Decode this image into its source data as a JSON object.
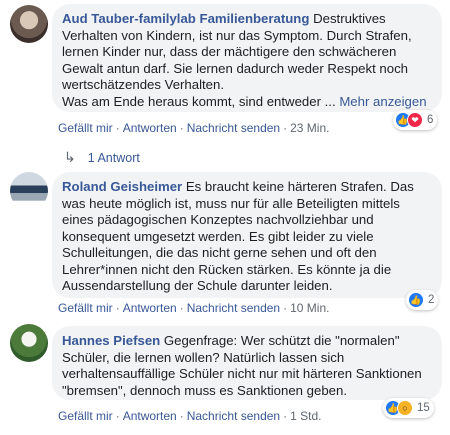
{
  "comments": [
    {
      "author": "Aud Tauber-familylab Familienberatung",
      "text": " Destruktives Verhalten von Kindern, ist nur das Symptom. Durch Strafen, lernen Kinder nur, dass der mächtigere den schwächeren Gewalt antun darf. Sie lernen dadurch weder Respekt noch wertschätzendes Verhalten.",
      "text2": "Was am Ende heraus kommt, sind entweder ...",
      "more": "Mehr anzeigen",
      "like": "Gefällt mir",
      "answer": "Antworten",
      "message": "Nachricht senden",
      "time": "23 Min.",
      "reaction_count": "6",
      "reactions": [
        "like-icon",
        "love-icon"
      ]
    },
    {
      "author": "Roland Geisheimer",
      "text": " Es braucht keine härteren Strafen. Das was heute möglich ist, muss nur für alle Beteiligten mittels eines pädagogischen Konzeptes nachvollziehbar und konsequent umgesetzt werden. Es gibt leider zu viele Schulleitungen, die das nicht gerne sehen und oft den Lehrer*innen nicht den Rücken stärken. Es könnte ja die Aussendarstellung der Schule darunter leiden.",
      "like": "Gefällt mir",
      "answer": "Antworten",
      "message": "Nachricht senden",
      "time": "10 Min.",
      "reaction_count": "2",
      "reactions": [
        "like-icon"
      ]
    },
    {
      "author": "Hannes Piefsen",
      "text": " Gegenfrage: Wer schützt die \"normalen\" Schüler, die lernen wollen? Natürlich lassen sich verhaltensauffällige Schüler nicht nur mit härteren Sanktionen \"bremsen\", dennoch muss es Sanktionen geben.",
      "like": "Gefällt mir",
      "answer": "Antworten",
      "message": "Nachricht senden",
      "time": "1 Std.",
      "reaction_count": "15",
      "reactions": [
        "like-icon",
        "wow-icon"
      ]
    }
  ],
  "reply_link": "1 Antwort",
  "colors": {
    "link": "#385898",
    "bubble": "#f2f3f5",
    "like": "#2078f4",
    "love": "#f0284a",
    "wow": "#f7b125"
  }
}
